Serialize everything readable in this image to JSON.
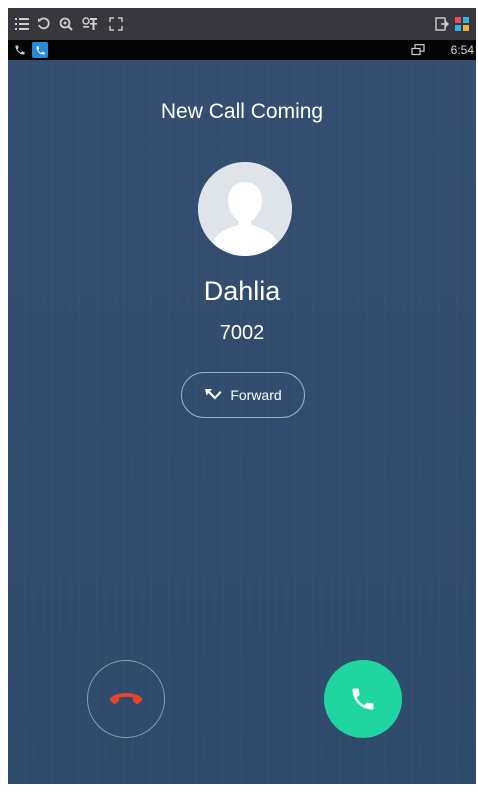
{
  "toolbar": {
    "icons": [
      "list-icon",
      "refresh-icon",
      "zoom-icon",
      "language-icon",
      "fullscreen-icon",
      "exit-icon",
      "app-grid-icon"
    ]
  },
  "status_bar": {
    "icons": [
      "phone-icon",
      "phone-app-icon",
      "screen-mirror-icon"
    ],
    "time": "6:54"
  },
  "call": {
    "title": "New Call Coming",
    "caller_name": "Dahlia",
    "caller_number": "7002",
    "forward_label": "Forward"
  },
  "colors": {
    "background": "#2f4a6c",
    "answer": "#1fd6a0",
    "decline_icon": "#e8442a"
  }
}
